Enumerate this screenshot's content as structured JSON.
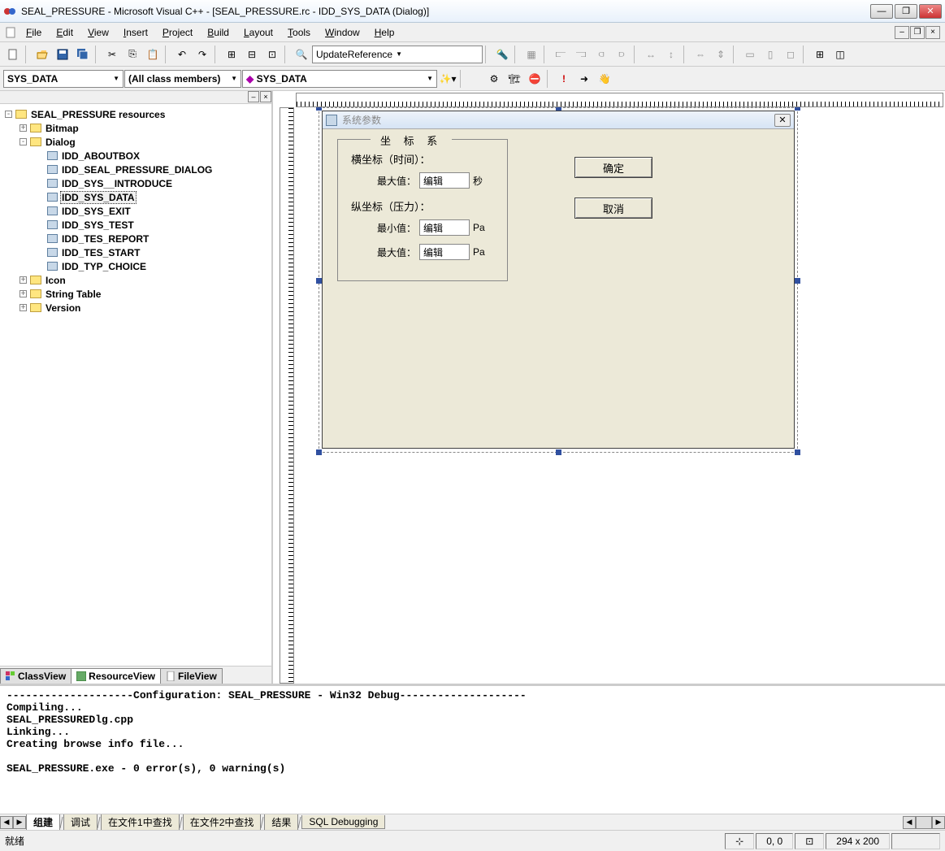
{
  "window": {
    "title": "SEAL_PRESSURE - Microsoft Visual C++ - [SEAL_PRESSURE.rc - IDD_SYS_DATA (Dialog)]"
  },
  "menu": [
    "File",
    "Edit",
    "View",
    "Insert",
    "Project",
    "Build",
    "Layout",
    "Tools",
    "Window",
    "Help"
  ],
  "toolbar1": {
    "combo": "UpdateReference"
  },
  "toolbar2": {
    "class_combo": "SYS_DATA",
    "member_combo": "(All class members)",
    "symbol_combo": "SYS_DATA"
  },
  "tree": {
    "root": "SEAL_PRESSURE resources",
    "bitmap": "Bitmap",
    "dialog": "Dialog",
    "dialogs": [
      "IDD_ABOUTBOX",
      "IDD_SEAL_PRESSURE_DIALOG",
      "IDD_SYS__INTRODUCE",
      "IDD_SYS_DATA",
      "IDD_SYS_EXIT",
      "IDD_SYS_TEST",
      "IDD_TES_REPORT",
      "IDD_TES_START",
      "IDD_TYP_CHOICE"
    ],
    "icon": "Icon",
    "string_table": "String Table",
    "version": "Version"
  },
  "view_tabs": {
    "class": "ClassView",
    "resource": "ResourceView",
    "file": "FileView"
  },
  "dialog_preview": {
    "title": "系统参数",
    "group_title": "坐 标 系",
    "h_label": "横坐标（时间）：",
    "h_max_lbl": "最大值：",
    "h_max_val": "编辑",
    "h_max_unit": "秒",
    "v_label": "纵坐标（压力）：",
    "v_min_lbl": "最小值：",
    "v_min_val": "编辑",
    "v_min_unit": "Pa",
    "v_max_lbl": "最大值：",
    "v_max_val": "编辑",
    "v_max_unit": "Pa",
    "btn_ok": "确定",
    "btn_cancel": "取消"
  },
  "output": {
    "lines": "--------------------Configuration: SEAL_PRESSURE - Win32 Debug--------------------\nCompiling...\nSEAL_PRESSUREDlg.cpp\nLinking...\nCreating browse info file...\n\nSEAL_PRESSURE.exe - 0 error(s), 0 warning(s)",
    "tabs": [
      "组建",
      "调试",
      "在文件1中查找",
      "在文件2中查找",
      "结果",
      "SQL Debugging"
    ]
  },
  "status": {
    "text": "就绪",
    "pos": "0, 0",
    "size": "294 x 200"
  }
}
